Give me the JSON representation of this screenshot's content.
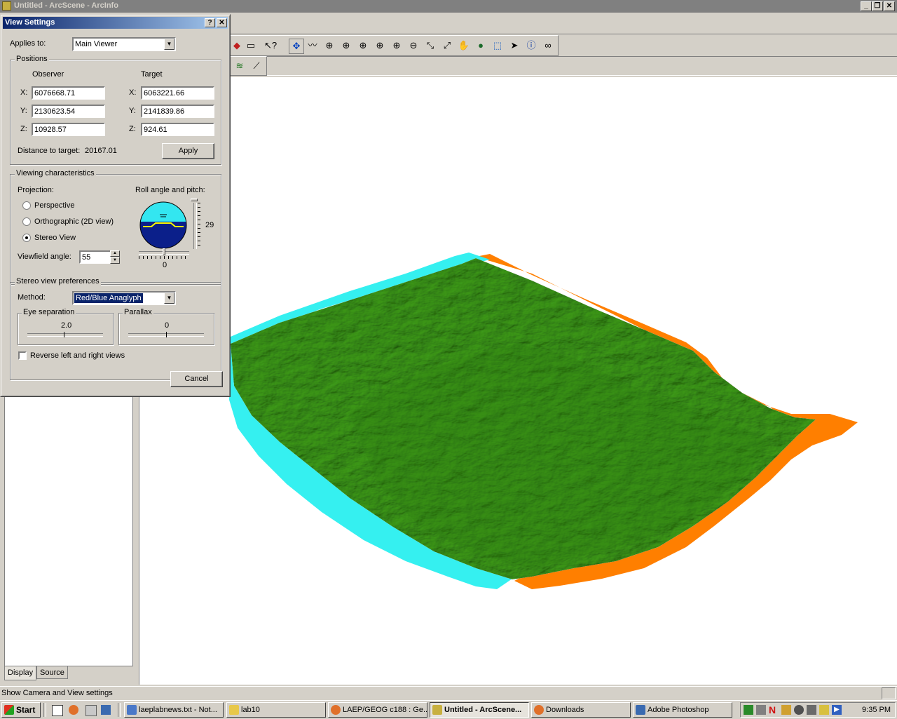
{
  "app": {
    "title": "Untitled - ArcScene - ArcInfo",
    "min_label": "_",
    "restore_label": "❐",
    "close_label": "✕"
  },
  "toc": {
    "tabs": [
      {
        "label": "Display"
      },
      {
        "label": "Source"
      }
    ]
  },
  "status": {
    "text": "Show Camera and View settings"
  },
  "dialog": {
    "title": "View Settings",
    "help_label": "?",
    "close_label": "✕",
    "applies_to_label": "Applies to:",
    "applies_to_value": "Main Viewer",
    "positions": {
      "group_label": "Positions",
      "observer_label": "Observer",
      "target_label": "Target",
      "x_label": "X:",
      "y_label": "Y:",
      "z_label": "Z:",
      "observer_x": "6076668.71",
      "observer_y": "2130623.54",
      "observer_z": "10928.57",
      "target_x": "6063221.66",
      "target_y": "2141839.86",
      "target_z": "924.61",
      "distance_label": "Distance to target:",
      "distance_value": "20167.01",
      "apply_label": "Apply"
    },
    "viewing": {
      "group_label": "Viewing characteristics",
      "projection_label": "Projection:",
      "options": [
        "Perspective",
        "Orthographic (2D view)",
        "Stereo View"
      ],
      "selected": "Stereo View",
      "roll_pitch_label": "Roll angle and pitch:",
      "pitch_value": "29",
      "roll_value": "0",
      "viewfield_label": "Viewfield angle:",
      "viewfield_value": "55"
    },
    "stereo": {
      "group_label": "Stereo view preferences",
      "method_label": "Method:",
      "method_value": "Red/Blue Anaglyph",
      "eye_sep_label": "Eye separation",
      "eye_sep_value": "2.0",
      "parallax_label": "Parallax",
      "parallax_value": "0",
      "reverse_label": "Reverse left and right views",
      "reverse_checked": false
    },
    "cancel_label": "Cancel"
  },
  "taskbar": {
    "start_label": "Start",
    "buttons": [
      {
        "label": "laeplabnews.txt - Not...",
        "icon_color": "#4a78c8"
      },
      {
        "label": "lab10",
        "icon_color": "#e8c84a"
      },
      {
        "label": "LAEP/GEOG c188 : Ge...",
        "icon_color": "#e0702a"
      },
      {
        "label": "Untitled - ArcScene...",
        "icon_color": "#c8b040"
      },
      {
        "label": "Downloads",
        "icon_color": "#e0702a"
      },
      {
        "label": "Adobe Photoshop",
        "icon_color": "#3a6ab0"
      }
    ],
    "clock": "9:35 PM"
  }
}
